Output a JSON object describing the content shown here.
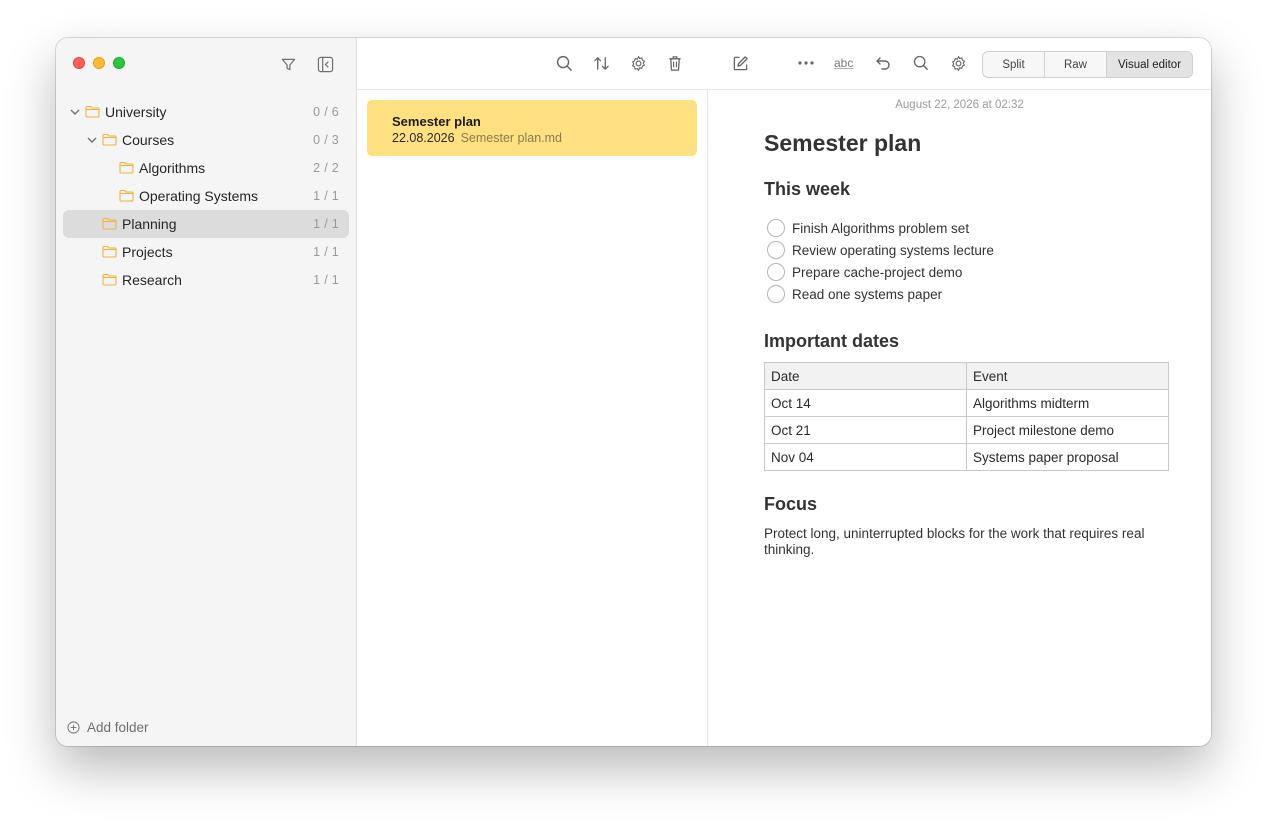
{
  "sidebar": {
    "tree": [
      {
        "label": "University",
        "count": "0 / 6",
        "expanded": true
      },
      {
        "label": "Courses",
        "count": "0 / 3",
        "expanded": true
      },
      {
        "label": "Algorithms",
        "count": "2 / 2"
      },
      {
        "label": "Operating Systems",
        "count": "1 / 1"
      },
      {
        "label": "Planning",
        "count": "1 / 1",
        "selected": true
      },
      {
        "label": "Projects",
        "count": "1 / 1"
      },
      {
        "label": "Research",
        "count": "1 / 1"
      }
    ],
    "add_folder_label": "Add folder"
  },
  "toolbar": {
    "spellcheck_label": "abc",
    "view_modes": {
      "split": "Split",
      "raw": "Raw",
      "visual": "Visual editor"
    },
    "active_mode": "Visual editor"
  },
  "notes_list": [
    {
      "title": "Semester plan",
      "date": "22.08.2026",
      "filename": "Semester plan.md"
    }
  ],
  "editor": {
    "timestamp": "August 22, 2026 at 02:32",
    "title": "Semester plan",
    "this_week_heading": "This week",
    "tasks": [
      "Finish Algorithms problem set",
      "Review operating systems lecture",
      "Prepare cache-project demo",
      "Read one systems paper"
    ],
    "dates_heading": "Important dates",
    "table": {
      "headers": [
        "Date",
        "Event"
      ],
      "rows": [
        [
          "Oct 14",
          "Algorithms midterm"
        ],
        [
          "Oct 21",
          "Project milestone demo"
        ],
        [
          "Nov 04",
          "Systems paper proposal"
        ]
      ]
    },
    "focus_heading": "Focus",
    "focus_text": "Protect long, uninterrupted blocks for the work that requires real thinking."
  },
  "colors": {
    "selected_note": "#ffe182",
    "folder_icon": "#f0b340",
    "selected_folder_row": "#dcdcdc"
  },
  "icons": {
    "window_controls": [
      "close-icon",
      "minimize-icon",
      "zoom-icon"
    ],
    "sidebar": [
      "filter-icon",
      "sidebar-toggle-icon"
    ],
    "toolbar_left": [
      "search-icon",
      "sort-icon",
      "settings-icon",
      "trash-icon"
    ],
    "toolbar_right": [
      "new-note-icon",
      "more-icon",
      "spellcheck-icon",
      "undo-icon",
      "search-icon",
      "settings-icon"
    ]
  }
}
